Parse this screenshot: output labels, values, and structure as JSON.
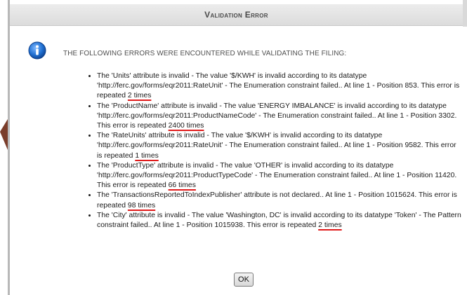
{
  "dialog": {
    "title": "Validation Error",
    "intro": "The following errors were encountered while validating the filing:",
    "ok_label": "OK"
  },
  "errors": [
    {
      "text": "The 'Units' attribute is invalid - The value '$/KWH' is invalid according to its datatype 'http://ferc.gov/forms/eqr2011:RateUnit' - The Enumeration constraint failed.. At line 1 - Position 853. This error is repeated ",
      "count": "2 times"
    },
    {
      "text": "The 'ProductName' attribute is invalid - The value 'ENERGY IMBALANCE' is invalid according to its datatype 'http://ferc.gov/forms/eqr2011:ProductNameCode' - The Enumeration constraint failed.. At line 1 - Position 3302. This error is repeated ",
      "count": "2400 times"
    },
    {
      "text": "The 'RateUnits' attribute is invalid - The value '$/KWH' is invalid according to its datatype 'http://ferc.gov/forms/eqr2011:RateUnit' - The Enumeration constraint failed.. At line 1 - Position 9582. This error is repeated ",
      "count": "1 times"
    },
    {
      "text": "The 'ProductType' attribute is invalid - The value 'OTHER' is invalid according to its datatype 'http://ferc.gov/forms/eqr2011:ProductTypeCode' - The Enumeration constraint failed.. At line 1 - Position 11420. This error is repeated ",
      "count": "66 times"
    },
    {
      "text": "The 'TransactionsReportedToIndexPublisher' attribute is not declared.. At line 1 - Position 1015624. This error is repeated ",
      "count": "98 times"
    },
    {
      "text": "The 'City' attribute is invalid - The value 'Washington, DC' is invalid according to its datatype 'Token' - The Pattern constraint failed.. At line 1 - Position 1015938. This error is repeated ",
      "count": "2 times"
    }
  ],
  "colors": {
    "underline": "#e01a1a",
    "info_icon": "#1f6fd1",
    "side_arrow": "#7a3d2a"
  },
  "icons": {
    "info": "info-icon"
  }
}
